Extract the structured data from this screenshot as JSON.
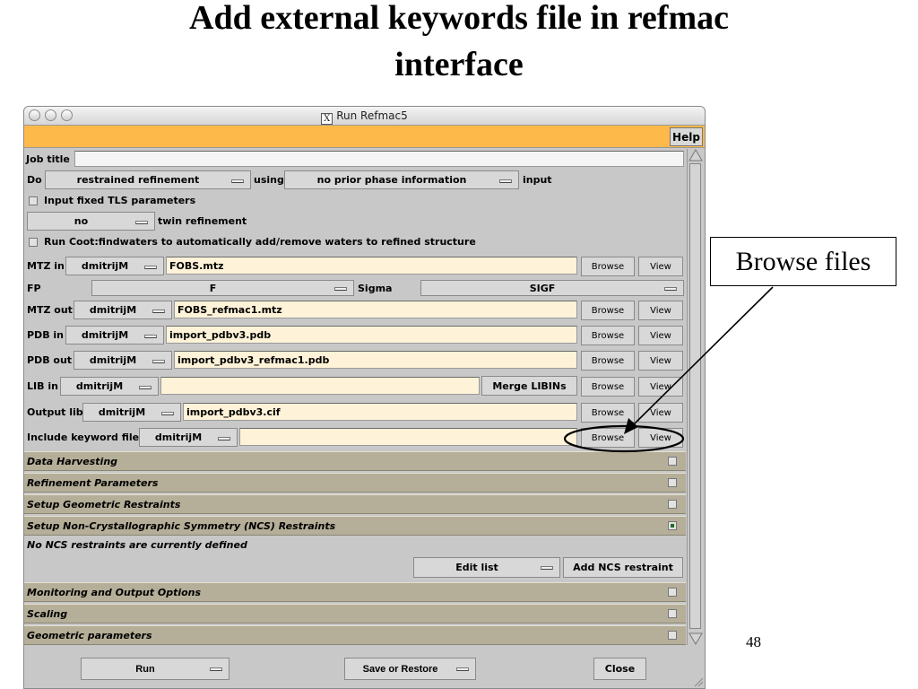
{
  "slide": {
    "title_line1": "Add external keywords file in refmac",
    "title_line2": "interface",
    "callout": "Browse files",
    "page_number": "48"
  },
  "window": {
    "title": "Run Refmac5",
    "title_icon": "X",
    "help": "Help"
  },
  "job": {
    "label": "Job title",
    "value": ""
  },
  "do_row": {
    "label": "Do",
    "mode": "restrained refinement",
    "using": "using",
    "phase": "no prior phase information",
    "input": "input"
  },
  "tls": {
    "label": "Input fixed TLS parameters"
  },
  "twin": {
    "value": "no",
    "label": "twin refinement"
  },
  "coot": {
    "label": "Run Coot:findwaters to automatically add/remove waters to refined structure"
  },
  "files": [
    {
      "label": "MTZ in",
      "project": "dmitrijM",
      "value": "FOBS.mtz",
      "browse": "Browse",
      "view": "View"
    },
    {
      "label": "MTZ out",
      "project": "dmitrijM",
      "value": "FOBS_refmac1.mtz",
      "browse": "Browse",
      "view": "View"
    },
    {
      "label": "PDB in",
      "project": "dmitrijM",
      "value": "import_pdbv3.pdb",
      "browse": "Browse",
      "view": "View"
    },
    {
      "label": "PDB out",
      "project": "dmitrijM",
      "value": "import_pdbv3_refmac1.pdb",
      "browse": "Browse",
      "view": "View"
    },
    {
      "label": "LIB in",
      "project": "dmitrijM",
      "value": "",
      "merge": "Merge LIBINs",
      "browse": "Browse",
      "view": "View"
    },
    {
      "label": "Output lib",
      "project": "dmitrijM",
      "value": "import_pdbv3.cif",
      "browse": "Browse",
      "view": "View"
    },
    {
      "label": "Include keyword file",
      "project": "dmitrijM",
      "value": "",
      "browse": "Browse",
      "view": "View"
    }
  ],
  "fp_row": {
    "label": "FP",
    "fp": "F",
    "sigma_label": "Sigma",
    "sigma": "SIGF"
  },
  "sections": [
    {
      "label": "Data Harvesting",
      "checked": false
    },
    {
      "label": "Refinement Parameters",
      "checked": false
    },
    {
      "label": "Setup Geometric Restraints",
      "checked": false
    },
    {
      "label": "Setup Non-Crystallographic Symmetry (NCS) Restraints",
      "checked": true
    }
  ],
  "ncs": {
    "message": "No NCS restraints are currently defined",
    "edit_list": "Edit list",
    "add": "Add NCS restraint"
  },
  "sections2": [
    {
      "label": "Monitoring and Output Options",
      "checked": false
    },
    {
      "label": "Scaling",
      "checked": false
    },
    {
      "label": "Geometric parameters",
      "checked": false
    }
  ],
  "footer": {
    "run": "Run",
    "save": "Save or Restore",
    "close": "Close"
  },
  "colors": {
    "header_bar": "#fdb94a",
    "field_bg": "#fef2d8",
    "section_bg": "#b5ae98",
    "window_bg": "#c8c8c8"
  }
}
